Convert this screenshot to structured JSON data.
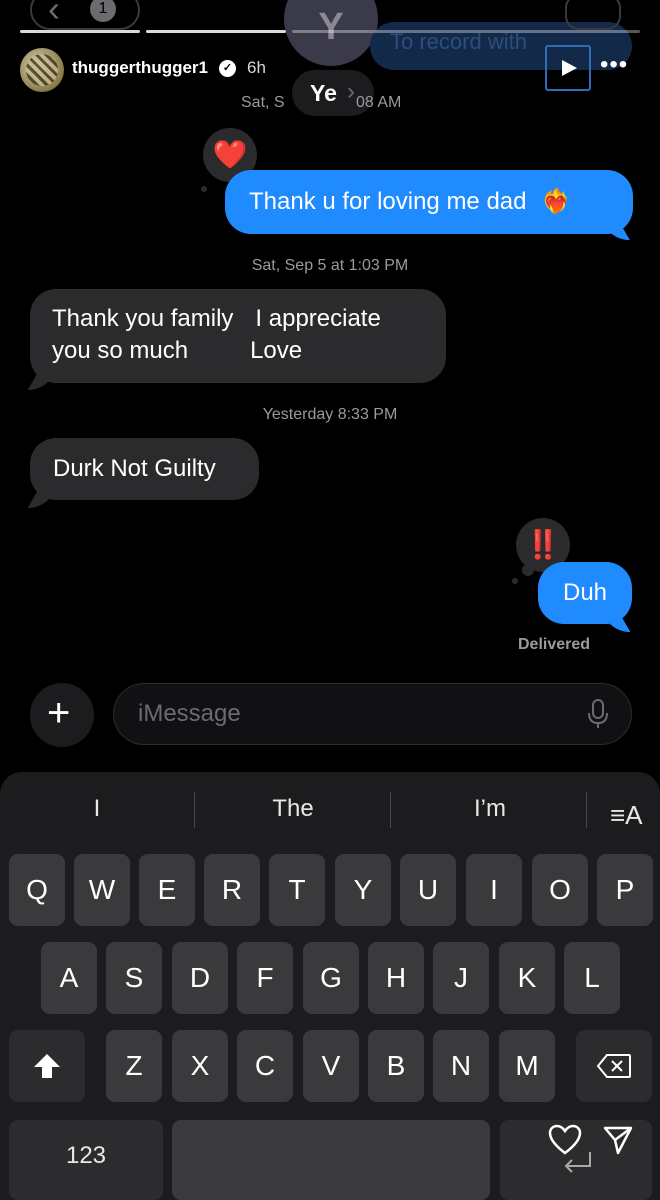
{
  "ghost_header": {
    "back_count": "1",
    "contact_initial": "Y",
    "contact_name": "Ye",
    "record_hint": "To record with"
  },
  "story": {
    "username": "thuggerthugger1",
    "verified_icon": "verified-badge-icon",
    "age": "6h",
    "play_icon": "play-icon",
    "more_icon": "more-dots-icon"
  },
  "messages": {
    "ts1": "Sat, Sep 5 at 1:08 AM",
    "ts1_visible": "Sat, S",
    "ts1_tail": "08 AM",
    "msg1": "Thank u for loving me dad",
    "msg1_emoji": "❤️‍🔥",
    "msg1_reaction": "❤️",
    "ts2": "Sat, Sep 5 at 1:03 PM",
    "msg2_line1_a": "Thank you family",
    "msg2_line1_b": "I appreciate",
    "msg2_line2_a": "you so much",
    "msg2_line2_b": "Love",
    "ts3": "Yesterday 8:33 PM",
    "msg3": "Durk Not Guilty",
    "msg4": "Duh",
    "msg4_reaction": "‼️",
    "status": "Delivered"
  },
  "composer": {
    "plus_icon": "plus-icon",
    "placeholder": "iMessage",
    "mic_icon": "microphone-icon"
  },
  "keyboard": {
    "suggestions": [
      "I",
      "The",
      "I’m"
    ],
    "format_icon": "text-format-icon",
    "format_label": "≡A",
    "row1": [
      "Q",
      "W",
      "E",
      "R",
      "T",
      "Y",
      "U",
      "I",
      "O",
      "P"
    ],
    "row2": [
      "A",
      "S",
      "D",
      "F",
      "G",
      "H",
      "J",
      "K",
      "L"
    ],
    "row3": [
      "Z",
      "X",
      "C",
      "V",
      "B",
      "N",
      "M"
    ],
    "shift_icon": "shift-arrow-icon",
    "delete_icon": "delete-backspace-icon",
    "numbers_label": "123",
    "return_icon": "return-icon"
  },
  "story_actions": {
    "like_icon": "heart-icon",
    "share_icon": "paper-plane-icon"
  },
  "colors": {
    "sent_bubble": "#1f8bff",
    "received_bubble": "#2b2b2d",
    "background": "#000000"
  }
}
